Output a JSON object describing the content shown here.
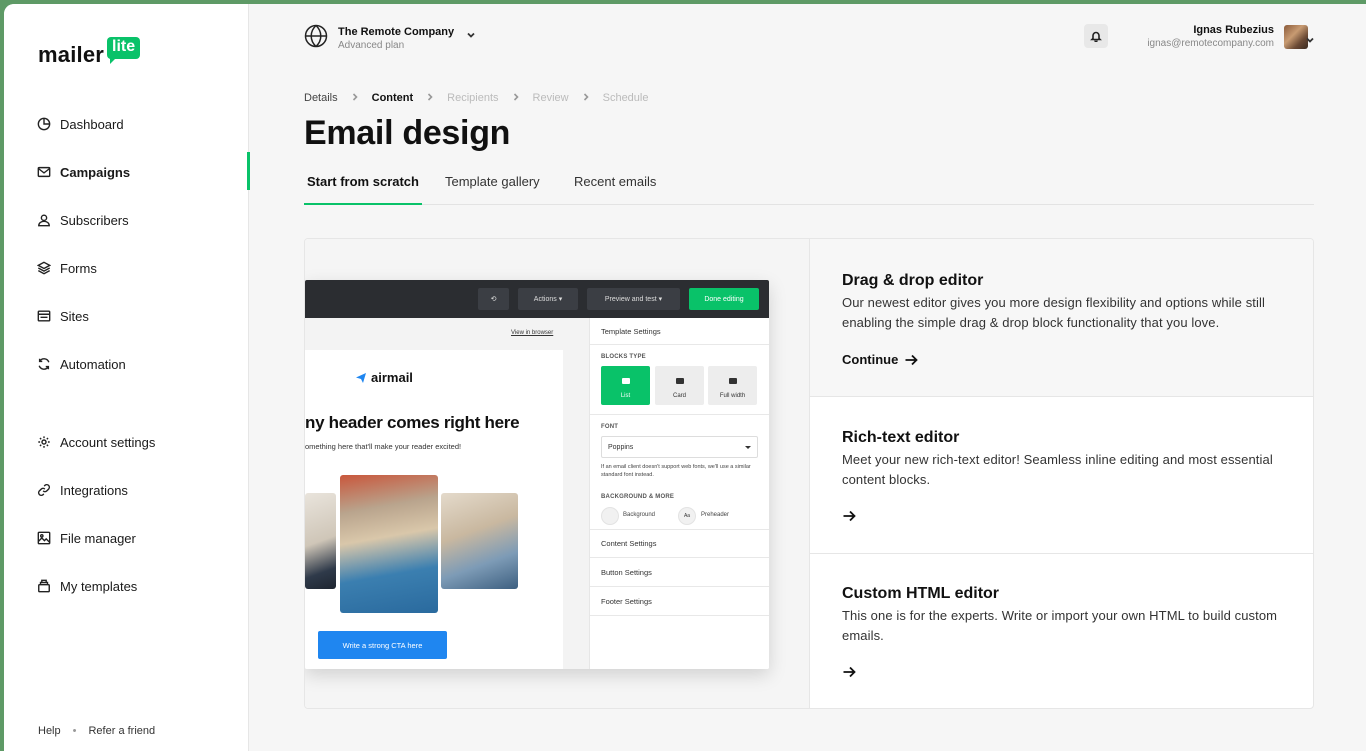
{
  "brand": {
    "word": "mailer",
    "badge": "lite",
    "accent": "#09c269"
  },
  "sidebar": {
    "items": [
      {
        "label": "Dashboard",
        "icon": "pie-chart-icon"
      },
      {
        "label": "Campaigns",
        "icon": "mail-icon",
        "active": true
      },
      {
        "label": "Subscribers",
        "icon": "user-icon"
      },
      {
        "label": "Forms",
        "icon": "layers-icon"
      },
      {
        "label": "Sites",
        "icon": "browser-icon"
      },
      {
        "label": "Automation",
        "icon": "refresh-icon"
      },
      {
        "label": "Account settings",
        "icon": "gear-icon"
      },
      {
        "label": "Integrations",
        "icon": "link-icon"
      },
      {
        "label": "File manager",
        "icon": "image-icon"
      },
      {
        "label": "My templates",
        "icon": "archive-icon"
      }
    ],
    "footer": {
      "help": "Help",
      "dot": "•",
      "refer": "Refer a friend"
    }
  },
  "header": {
    "org_name": "The Remote Company",
    "org_plan": "Advanced plan",
    "user_name": "Ignas Rubezius",
    "user_email": "ignas@remotecompany.com"
  },
  "breadcrumb": [
    {
      "label": "Details",
      "state": "done"
    },
    {
      "label": "Content",
      "state": "current"
    },
    {
      "label": "Recipients",
      "state": "todo"
    },
    {
      "label": "Review",
      "state": "todo"
    },
    {
      "label": "Schedule",
      "state": "todo"
    }
  ],
  "page_title": "Email design",
  "tabs": [
    {
      "label": "Start from scratch",
      "active": true
    },
    {
      "label": "Template gallery"
    },
    {
      "label": "Recent emails"
    }
  ],
  "preview": {
    "toolbar": {
      "actions": "Actions",
      "preview": "Preview and test",
      "done": "Done editing"
    },
    "view_link": "View in browser",
    "brand": "airmail",
    "heading": "ny header comes right here",
    "sub": "omething here that'll make your reader excited!",
    "cta": "Write a strong CTA here",
    "settings": {
      "template_settings": "Template Settings",
      "blocks_type_label": "BLOCKS TYPE",
      "blocks": [
        "List",
        "Card",
        "Full width"
      ],
      "font_label": "FONT",
      "font_value": "Poppins",
      "font_note": "If an email client doesn't support web fonts, we'll use a similar standard font instead.",
      "bg_label": "BACKGROUND & MORE",
      "background": "Background",
      "preheader_swatch": "Aa",
      "preheader": "Preheader",
      "content_settings": "Content Settings",
      "button_settings": "Button Settings",
      "footer_settings": "Footer Settings"
    }
  },
  "options": [
    {
      "title": "Drag & drop editor",
      "desc": "Our newest editor gives you more design flexibility and options while still enabling the simple drag & drop block functionality that you love.",
      "action": "Continue"
    },
    {
      "title": "Rich-text editor",
      "desc": "Meet your new rich-text editor! Seamless inline editing and most essential content blocks.",
      "action": ""
    },
    {
      "title": "Custom HTML editor",
      "desc": "This one is for the experts. Write or import your own HTML to build custom emails.",
      "action": ""
    }
  ]
}
